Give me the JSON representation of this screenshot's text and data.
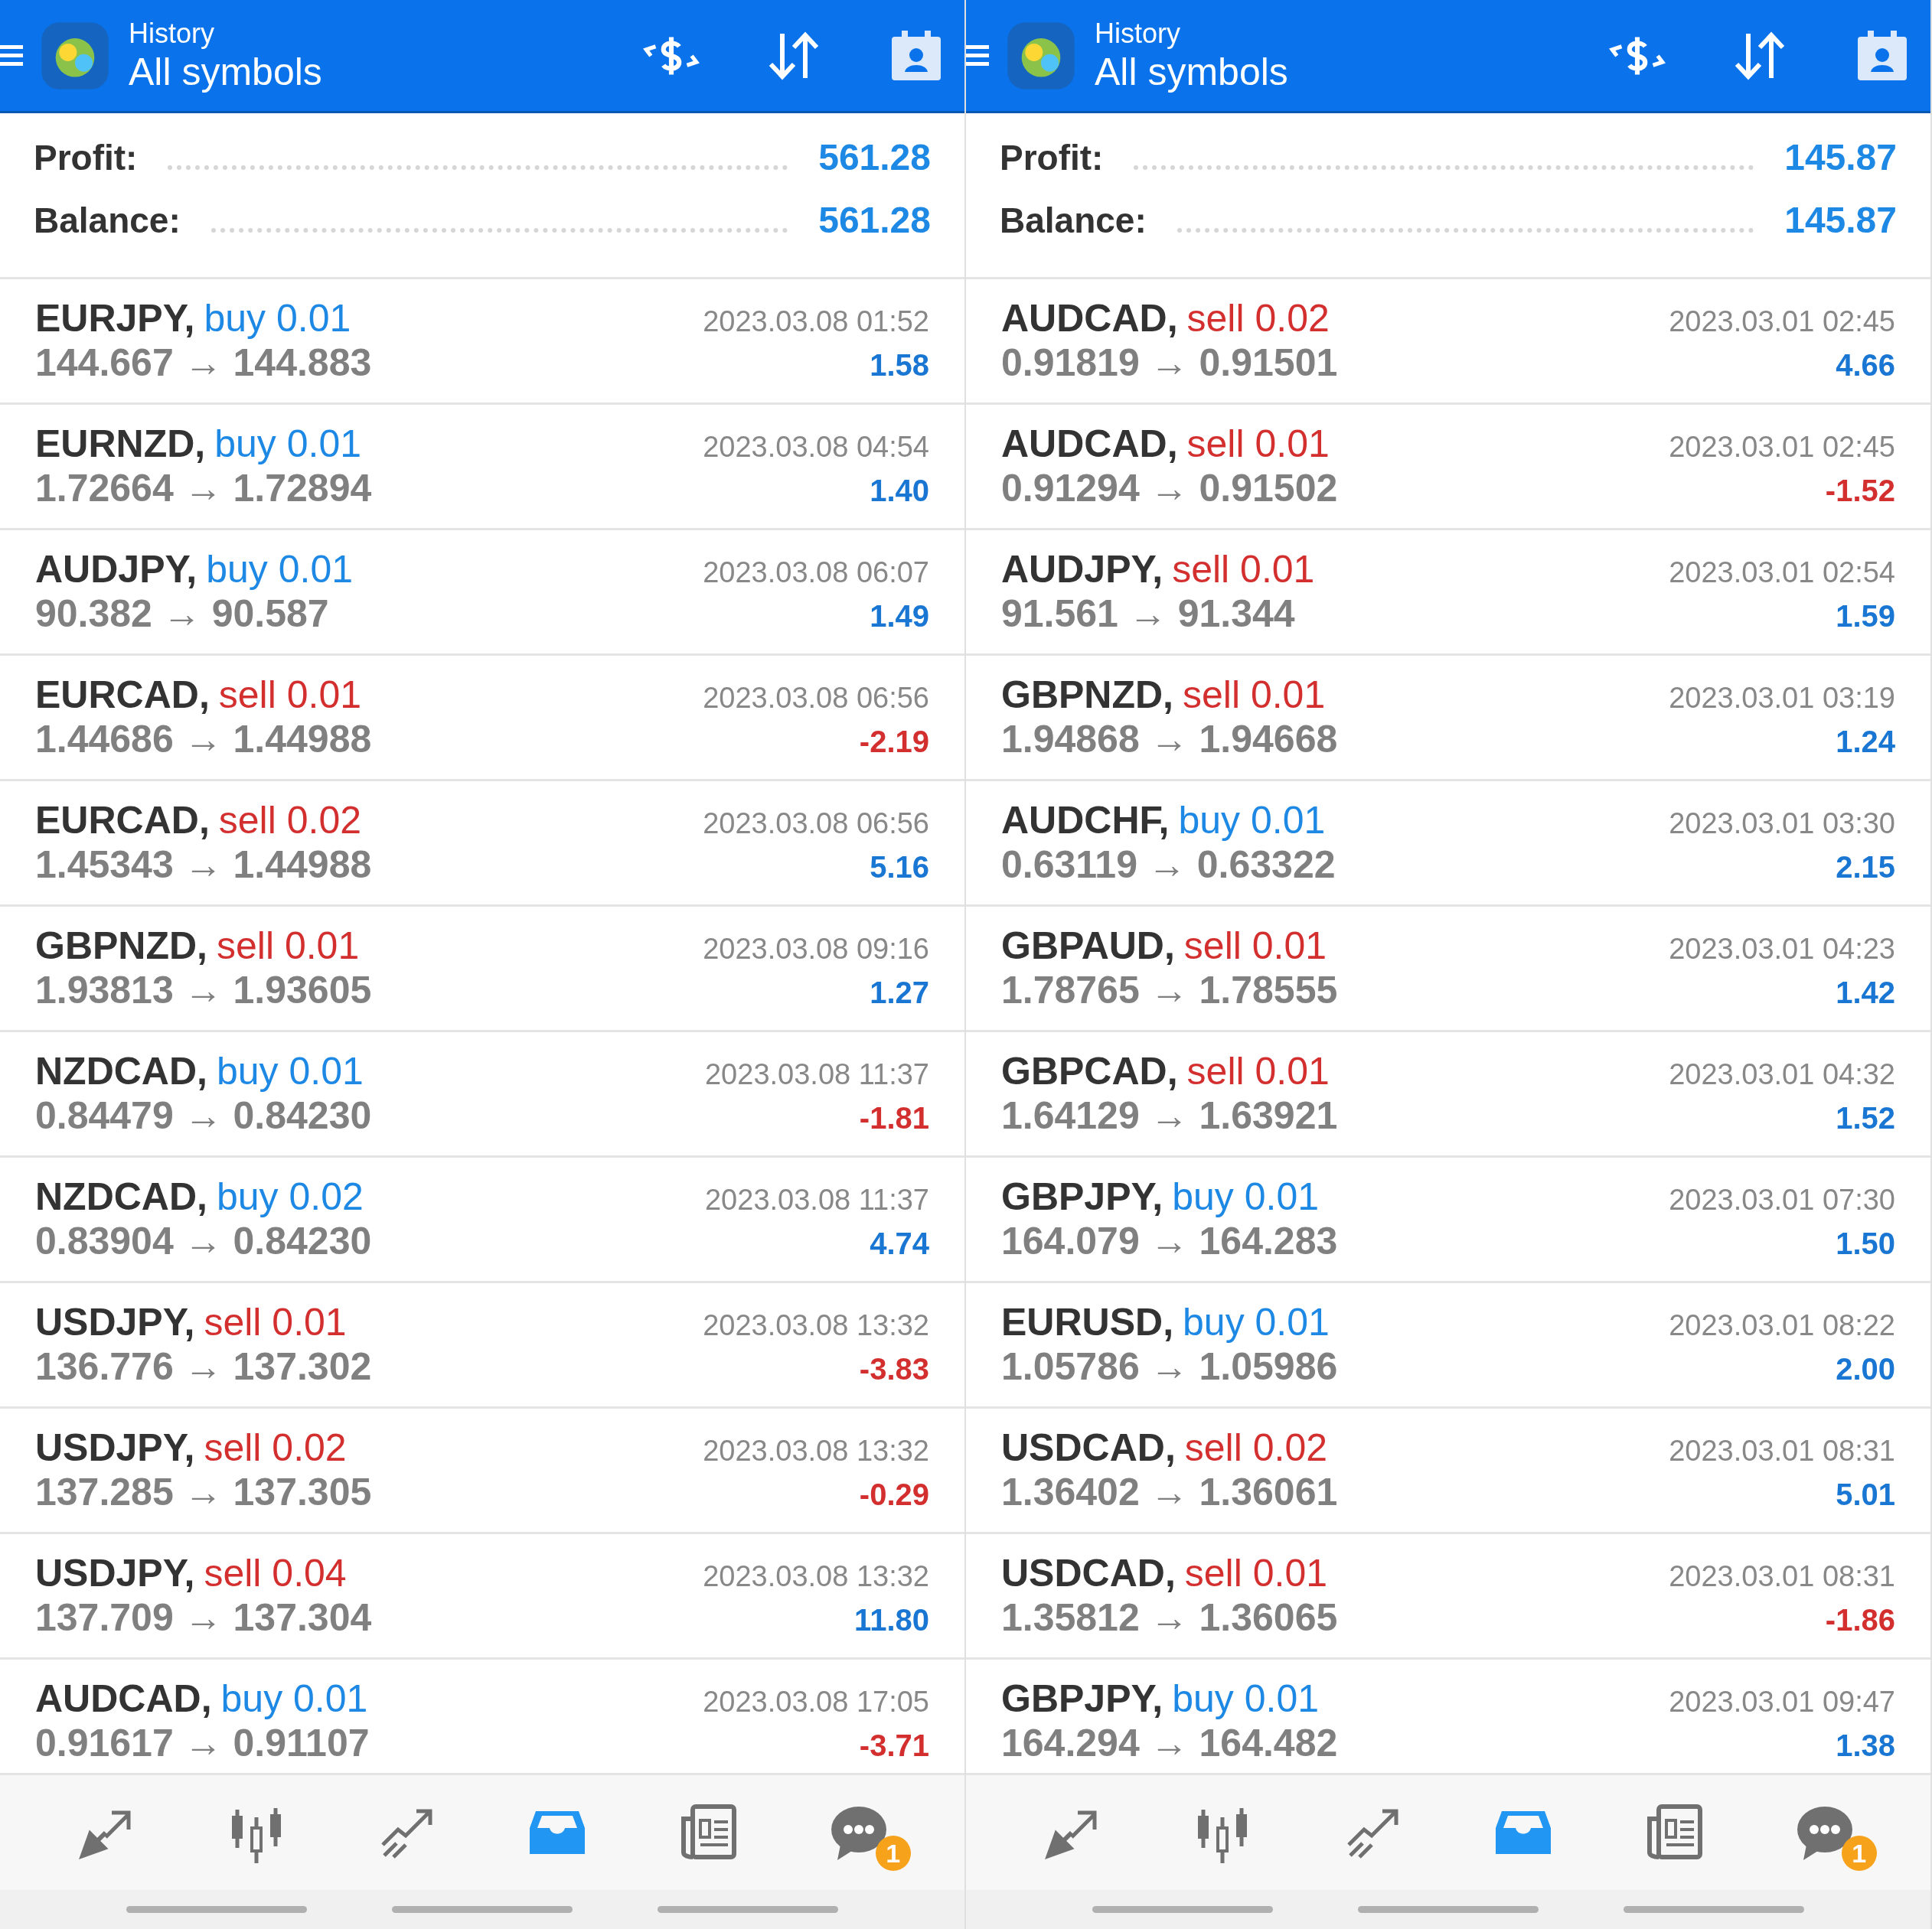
{
  "panels": [
    {
      "header": {
        "title": "History",
        "subtitle": "All symbols"
      },
      "summary": [
        {
          "label": "Profit:",
          "value": "561.28"
        },
        {
          "label": "Balance:",
          "value": "561.28"
        }
      ],
      "trades": [
        {
          "symbol": "EURJPY,",
          "order": {
            "text": "buy 0.01",
            "color": "#1e88e5"
          },
          "prices": "144.667 → 144.883",
          "time": "2023.03.08 01:52",
          "profit": {
            "text": "1.58",
            "color": "#1976d2"
          }
        },
        {
          "symbol": "EURNZD,",
          "order": {
            "text": "buy 0.01",
            "color": "#1e88e5"
          },
          "prices": "1.72664 → 1.72894",
          "time": "2023.03.08 04:54",
          "profit": {
            "text": "1.40",
            "color": "#1976d2"
          }
        },
        {
          "symbol": "AUDJPY,",
          "order": {
            "text": "buy 0.01",
            "color": "#1e88e5"
          },
          "prices": "90.382 → 90.587",
          "time": "2023.03.08 06:07",
          "profit": {
            "text": "1.49",
            "color": "#1976d2"
          }
        },
        {
          "symbol": "EURCAD,",
          "order": {
            "text": "sell 0.01",
            "color": "#d32f2f"
          },
          "prices": "1.44686 → 1.44988",
          "time": "2023.03.08 06:56",
          "profit": {
            "text": "-2.19",
            "color": "#d32f2f"
          }
        },
        {
          "symbol": "EURCAD,",
          "order": {
            "text": "sell 0.02",
            "color": "#d32f2f"
          },
          "prices": "1.45343 → 1.44988",
          "time": "2023.03.08 06:56",
          "profit": {
            "text": "5.16",
            "color": "#1976d2"
          }
        },
        {
          "symbol": "GBPNZD,",
          "order": {
            "text": "sell 0.01",
            "color": "#d32f2f"
          },
          "prices": "1.93813 → 1.93605",
          "time": "2023.03.08 09:16",
          "profit": {
            "text": "1.27",
            "color": "#1976d2"
          }
        },
        {
          "symbol": "NZDCAD,",
          "order": {
            "text": "buy 0.01",
            "color": "#1e88e5"
          },
          "prices": "0.84479 → 0.84230",
          "time": "2023.03.08 11:37",
          "profit": {
            "text": "-1.81",
            "color": "#d32f2f"
          }
        },
        {
          "symbol": "NZDCAD,",
          "order": {
            "text": "buy 0.02",
            "color": "#1e88e5"
          },
          "prices": "0.83904 → 0.84230",
          "time": "2023.03.08 11:37",
          "profit": {
            "text": "4.74",
            "color": "#1976d2"
          }
        },
        {
          "symbol": "USDJPY,",
          "order": {
            "text": "sell 0.01",
            "color": "#d32f2f"
          },
          "prices": "136.776 → 137.302",
          "time": "2023.03.08 13:32",
          "profit": {
            "text": "-3.83",
            "color": "#d32f2f"
          }
        },
        {
          "symbol": "USDJPY,",
          "order": {
            "text": "sell 0.02",
            "color": "#d32f2f"
          },
          "prices": "137.285 → 137.305",
          "time": "2023.03.08 13:32",
          "profit": {
            "text": "-0.29",
            "color": "#d32f2f"
          }
        },
        {
          "symbol": "USDJPY,",
          "order": {
            "text": "sell 0.04",
            "color": "#d32f2f"
          },
          "prices": "137.709 → 137.304",
          "time": "2023.03.08 13:32",
          "profit": {
            "text": "11.80",
            "color": "#1976d2"
          }
        },
        {
          "symbol": "AUDCAD,",
          "order": {
            "text": "buy 0.01",
            "color": "#1e88e5"
          },
          "prices": "0.91617 → 0.91107",
          "time": "2023.03.08 17:05",
          "profit": {
            "text": "-3.71",
            "color": "#d32f2f"
          }
        }
      ],
      "nav": [
        {
          "selected": false
        },
        {
          "selected": false
        },
        {
          "selected": false
        },
        {
          "selected": true
        },
        {
          "selected": false
        },
        {
          "selected": false,
          "badge": "1"
        }
      ]
    },
    {
      "header": {
        "title": "History",
        "subtitle": "All symbols"
      },
      "summary": [
        {
          "label": "Profit:",
          "value": "145.87"
        },
        {
          "label": "Balance:",
          "value": "145.87"
        }
      ],
      "trades": [
        {
          "symbol": "AUDCAD,",
          "order": {
            "text": "sell 0.02",
            "color": "#d32f2f"
          },
          "prices": "0.91819 → 0.91501",
          "time": "2023.03.01 02:45",
          "profit": {
            "text": "4.66",
            "color": "#1976d2"
          }
        },
        {
          "symbol": "AUDCAD,",
          "order": {
            "text": "sell 0.01",
            "color": "#d32f2f"
          },
          "prices": "0.91294 → 0.91502",
          "time": "2023.03.01 02:45",
          "profit": {
            "text": "-1.52",
            "color": "#d32f2f"
          }
        },
        {
          "symbol": "AUDJPY,",
          "order": {
            "text": "sell 0.01",
            "color": "#d32f2f"
          },
          "prices": "91.561 → 91.344",
          "time": "2023.03.01 02:54",
          "profit": {
            "text": "1.59",
            "color": "#1976d2"
          }
        },
        {
          "symbol": "GBPNZD,",
          "order": {
            "text": "sell 0.01",
            "color": "#d32f2f"
          },
          "prices": "1.94868 → 1.94668",
          "time": "2023.03.01 03:19",
          "profit": {
            "text": "1.24",
            "color": "#1976d2"
          }
        },
        {
          "symbol": "AUDCHF,",
          "order": {
            "text": "buy 0.01",
            "color": "#1e88e5"
          },
          "prices": "0.63119 → 0.63322",
          "time": "2023.03.01 03:30",
          "profit": {
            "text": "2.15",
            "color": "#1976d2"
          }
        },
        {
          "symbol": "GBPAUD,",
          "order": {
            "text": "sell 0.01",
            "color": "#d32f2f"
          },
          "prices": "1.78765 → 1.78555",
          "time": "2023.03.01 04:23",
          "profit": {
            "text": "1.42",
            "color": "#1976d2"
          }
        },
        {
          "symbol": "GBPCAD,",
          "order": {
            "text": "sell 0.01",
            "color": "#d32f2f"
          },
          "prices": "1.64129 → 1.63921",
          "time": "2023.03.01 04:32",
          "profit": {
            "text": "1.52",
            "color": "#1976d2"
          }
        },
        {
          "symbol": "GBPJPY,",
          "order": {
            "text": "buy 0.01",
            "color": "#1e88e5"
          },
          "prices": "164.079 → 164.283",
          "time": "2023.03.01 07:30",
          "profit": {
            "text": "1.50",
            "color": "#1976d2"
          }
        },
        {
          "symbol": "EURUSD,",
          "order": {
            "text": "buy 0.01",
            "color": "#1e88e5"
          },
          "prices": "1.05786 → 1.05986",
          "time": "2023.03.01 08:22",
          "profit": {
            "text": "2.00",
            "color": "#1976d2"
          }
        },
        {
          "symbol": "USDCAD,",
          "order": {
            "text": "sell 0.02",
            "color": "#d32f2f"
          },
          "prices": "1.36402 → 1.36061",
          "time": "2023.03.01 08:31",
          "profit": {
            "text": "5.01",
            "color": "#1976d2"
          }
        },
        {
          "symbol": "USDCAD,",
          "order": {
            "text": "sell 0.01",
            "color": "#d32f2f"
          },
          "prices": "1.35812 → 1.36065",
          "time": "2023.03.01 08:31",
          "profit": {
            "text": "-1.86",
            "color": "#d32f2f"
          }
        },
        {
          "symbol": "GBPJPY,",
          "order": {
            "text": "buy 0.01",
            "color": "#1e88e5"
          },
          "prices": "164.294 → 164.482",
          "time": "2023.03.01 09:47",
          "profit": {
            "text": "1.38",
            "color": "#1976d2"
          }
        }
      ],
      "nav": [
        {
          "selected": false
        },
        {
          "selected": false
        },
        {
          "selected": false
        },
        {
          "selected": true
        },
        {
          "selected": false
        },
        {
          "selected": false,
          "badge": "1"
        }
      ]
    }
  ]
}
